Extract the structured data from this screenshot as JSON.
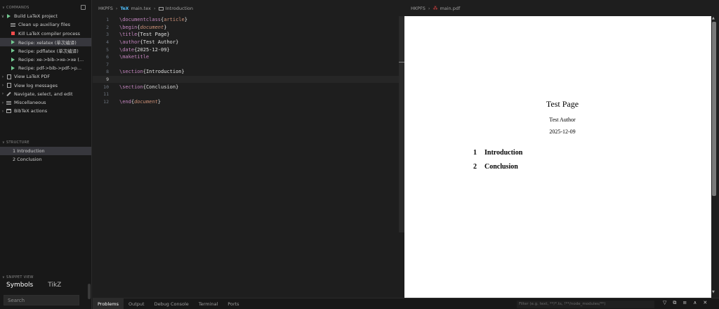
{
  "sidebar": {
    "commands_header": "COMMANDS",
    "commands": [
      {
        "label": "Build LaTeX project",
        "icon": "play-icon"
      },
      {
        "label": "Clean up auxiliary files",
        "icon": "clean-icon"
      },
      {
        "label": "Kill LaTeX compiler process",
        "icon": "stop-icon"
      },
      {
        "label": "Recipe: xelatex (单次编译)",
        "icon": "play-icon"
      },
      {
        "label": "Recipe: pdflatex (单次编译)",
        "icon": "play-icon"
      },
      {
        "label": "Recipe: xe->bib->xe->xe (...",
        "icon": "play-icon"
      },
      {
        "label": "Recipe: pdf->bib->pdf->p...",
        "icon": "play-icon"
      },
      {
        "label": "View LaTeX PDF",
        "icon": "pdf-view-icon"
      },
      {
        "label": "View log messages",
        "icon": "log-icon"
      },
      {
        "label": "Navigate, select, and edit",
        "icon": "pencil-icon"
      },
      {
        "label": "Miscellaneous",
        "icon": "misc-icon"
      },
      {
        "label": "BibTeX actions",
        "icon": "bibtex-icon"
      }
    ],
    "structure_header": "STRUCTURE",
    "structure": [
      "1 Introduction",
      "2 Conclusion"
    ],
    "snippet_header": "SNIPPET VIEW",
    "snippet_tabs": [
      "Symbols",
      "TikZ"
    ],
    "search_placeholder": "Search"
  },
  "editor": {
    "breadcrumb": [
      "HKPFS",
      "main.tex",
      "Introduction"
    ],
    "lines": [
      {
        "n": "1"
      },
      {
        "n": "2"
      },
      {
        "n": "3"
      },
      {
        "n": "4"
      },
      {
        "n": "5"
      },
      {
        "n": "6"
      },
      {
        "n": "7"
      },
      {
        "n": "8"
      },
      {
        "n": "9"
      },
      {
        "n": "10"
      },
      {
        "n": "11"
      },
      {
        "n": "12"
      }
    ],
    "code": {
      "l1_cmd": "\\documentclass",
      "l1_arg": "article",
      "l2_cmd": "\\begin",
      "l2_arg": "document",
      "l3_cmd": "\\title",
      "l3_arg": "Test Page",
      "l4_cmd": "\\author",
      "l4_arg": "Test Author",
      "l5_cmd": "\\date",
      "l5_arg": "2025-12-09",
      "l6_cmd": "\\maketitle",
      "l8_cmd": "\\section",
      "l8_arg": "Introduction",
      "l10_cmd": "\\section",
      "l10_arg": "Conclusion",
      "l12_cmd": "\\end",
      "l12_arg": "document"
    }
  },
  "pdf": {
    "breadcrumb": [
      "HKPFS",
      "main.pdf"
    ],
    "title": "Test Page",
    "author": "Test Author",
    "date": "2025-12-09",
    "sections": [
      {
        "num": "1",
        "title": "Introduction"
      },
      {
        "num": "2",
        "title": "Conclusion"
      }
    ]
  },
  "panel": {
    "tabs": [
      "Problems",
      "Output",
      "Debug Console",
      "Terminal",
      "Ports"
    ],
    "filter_placeholder": "Filter (e.g. text, **/*.ts, !**/node_modules/**)"
  },
  "colors": {
    "keyword": "#c586c0",
    "brace": "#e0e0e0",
    "argument": "#ce9178",
    "play": "#73c991",
    "stop": "#f14c4c",
    "pdf_icon": "#e04343"
  }
}
